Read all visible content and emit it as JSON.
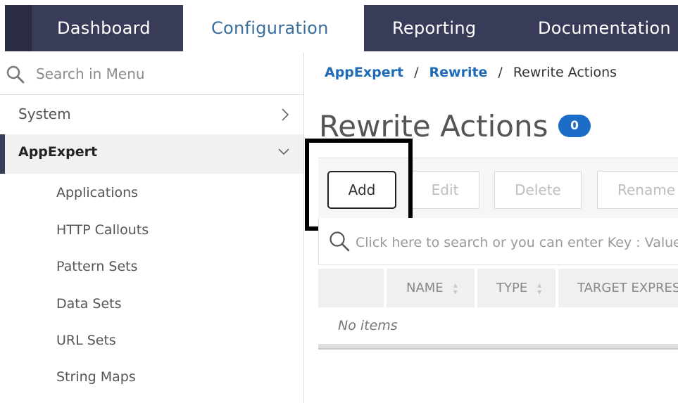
{
  "topnav": {
    "tabs": [
      {
        "label": "Dashboard"
      },
      {
        "label": "Configuration"
      },
      {
        "label": "Reporting"
      },
      {
        "label": "Documentation"
      }
    ],
    "active_tab": "Configuration"
  },
  "sidebar": {
    "search_placeholder": "Search in Menu",
    "items": [
      {
        "label": "System",
        "icon": "chevron-right-icon"
      },
      {
        "label": "AppExpert",
        "icon": "chevron-down-icon",
        "expanded": true
      }
    ],
    "sub_items": [
      {
        "label": "Applications"
      },
      {
        "label": "HTTP Callouts"
      },
      {
        "label": "Pattern Sets"
      },
      {
        "label": "Data Sets"
      },
      {
        "label": "URL Sets"
      },
      {
        "label": "String Maps"
      }
    ]
  },
  "breadcrumb": {
    "items": [
      {
        "label": "AppExpert"
      },
      {
        "label": "Rewrite"
      }
    ],
    "separator": "/",
    "current": "Rewrite Actions"
  },
  "page": {
    "title": "Rewrite Actions",
    "count": "0"
  },
  "toolbar": {
    "add_label": "Add",
    "edit_label": "Edit",
    "delete_label": "Delete",
    "rename_label": "Rename"
  },
  "grid": {
    "search_placeholder": "Click here to search or you can enter Key : Value f",
    "columns": [
      {
        "label": "NAME"
      },
      {
        "label": "TYPE"
      },
      {
        "label": "TARGET EXPRES"
      }
    ],
    "empty_text": "No items"
  },
  "colors": {
    "nav_bg": "#383c58",
    "link": "#1f6bb6",
    "badge": "#1a6cc7",
    "highlight": "#000000"
  }
}
